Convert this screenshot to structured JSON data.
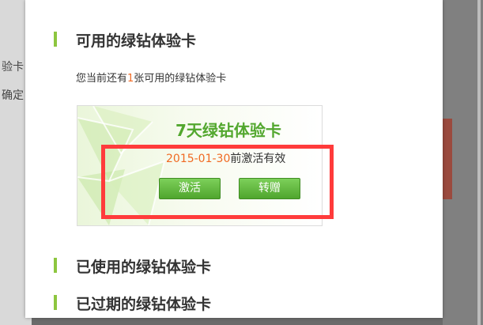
{
  "background": {
    "text_line_1": "验卡",
    "text_line_2": "确定"
  },
  "modal": {
    "sections": {
      "available_title": "可用的绿钻体验卡",
      "used_title": "已使用的绿钻体验卡",
      "expired_title": "已过期的绿钻体验卡"
    },
    "intro": {
      "prefix": "您当前还有",
      "count": "1",
      "suffix": "张可用的绿钻体验卡"
    },
    "card": {
      "title": "7天绿钻体验卡",
      "expire_date": "2015-01-30",
      "expire_suffix": "前激活有效",
      "activate_label": "激活",
      "gift_label": "转赠"
    }
  },
  "colors": {
    "accent_green": "#8dc63f",
    "card_title_green": "#52a72e",
    "highlight_orange": "#f06a23",
    "annotation_red": "#ff3b3b"
  }
}
